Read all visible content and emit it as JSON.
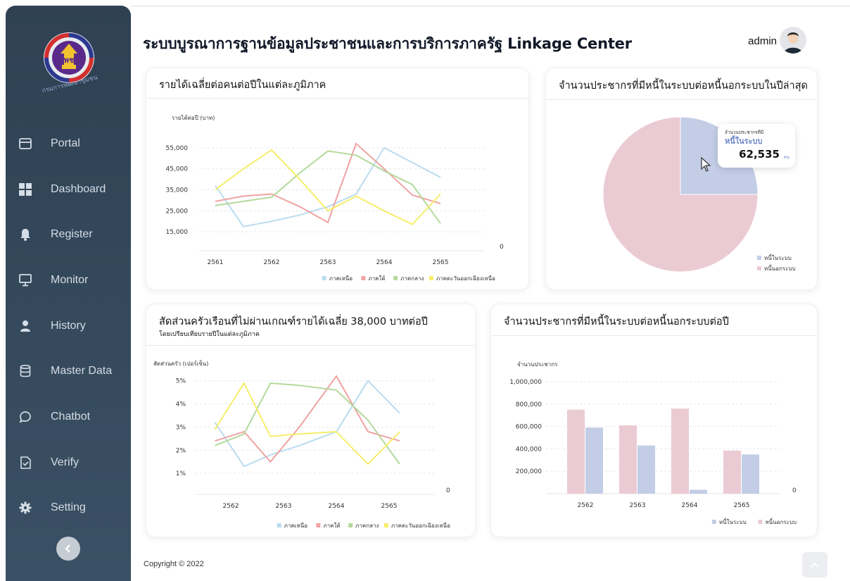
{
  "header": {
    "title": "ระบบบูรณาการฐานข้อมูลประชาชนและการบริการภาครัฐ  Linkage Center",
    "user": "admin"
  },
  "logo_text": "กรมการพัฒนาชุมชน",
  "sidebar": {
    "items": [
      {
        "label": "Portal",
        "icon": "portal-icon"
      },
      {
        "label": "Dashboard",
        "icon": "dashboard-icon"
      },
      {
        "label": "Register",
        "icon": "bell-icon"
      },
      {
        "label": "Monitor",
        "icon": "monitor-icon"
      },
      {
        "label": "History",
        "icon": "user-icon"
      },
      {
        "label": "Master Data",
        "icon": "database-icon"
      },
      {
        "label": "Chatbot",
        "icon": "chat-icon"
      },
      {
        "label": "Verify",
        "icon": "verify-icon"
      },
      {
        "label": "Setting",
        "icon": "gear-icon"
      }
    ]
  },
  "colors": {
    "north": "#b9dcef",
    "south": "#f0a3a3",
    "central": "#b5d99c",
    "northeast": "#f6ee6a",
    "in_system": "#c3cde6",
    "out_system": "#ebcbd3"
  },
  "chart_data": [
    {
      "type": "line",
      "title": "รายได้เฉลี่ยต่อคนต่อปีในแต่ละภูมิภาค",
      "ylabel": "รายได้ต่อปี (บาท)",
      "y_ticks": [
        "55,000",
        "45,000",
        "35,000",
        "25,000",
        "15,000"
      ],
      "y_tick_values": [
        55000,
        45000,
        35000,
        25000,
        15000
      ],
      "zero_label": "0",
      "categories": [
        "2561",
        "2562",
        "2563",
        "2564",
        "2565"
      ],
      "ylim": [
        5000,
        60000
      ],
      "legend_position": "bottom-right",
      "grid": true,
      "series": [
        {
          "name": "ภาคเหนือ",
          "color": "#b9dcef",
          "x": [
            1,
            1.5,
            2,
            2.5,
            3,
            3.5,
            4,
            4.5,
            5
          ],
          "values": [
            37000,
            17500,
            20000,
            23000,
            27000,
            33000,
            55000,
            48000,
            41000
          ]
        },
        {
          "name": "ภาคใต้",
          "color": "#f0a3a3",
          "x": [
            1,
            1.5,
            2,
            2.5,
            3,
            3.5,
            4,
            4.5,
            5
          ],
          "values": [
            29500,
            32000,
            33000,
            27000,
            19500,
            57000,
            45000,
            32500,
            28500
          ]
        },
        {
          "name": "ภาคกลาง",
          "color": "#b5d99c",
          "x": [
            1,
            1.5,
            2,
            2.5,
            3,
            3.5,
            4,
            4.5,
            5
          ],
          "values": [
            27500,
            29500,
            31500,
            43000,
            53500,
            51500,
            44000,
            37500,
            19000
          ]
        },
        {
          "name": "ภาคตะวันออกเฉียงเหนือ",
          "color": "#f6ee6a",
          "x": [
            1,
            1.5,
            2,
            2.5,
            3,
            3.5,
            4,
            4.5,
            5
          ],
          "values": [
            35000,
            45000,
            54000,
            40000,
            25000,
            32000,
            25000,
            18500,
            33000
          ]
        }
      ]
    },
    {
      "type": "pie",
      "title": "จำนวนประชากรที่มีหนี้ในระบบต่อหนี้นอกระบบในปีล่าสุด",
      "series": [
        {
          "name": "หนี้ในระบบ",
          "color": "#c3cde6",
          "value": 25
        },
        {
          "name": "หนี้นอกระบบ",
          "color": "#ebcbd3",
          "value": 75
        }
      ],
      "legend_position": "bottom-right",
      "tooltip": {
        "caption": "จำนวนประชากรที่มี",
        "series": "หนี้ในระบบ",
        "value": "62,535",
        "unit": "คน"
      }
    },
    {
      "type": "line",
      "title": "สัดส่วนครัวเรือนที่ไม่ผ่านเกณฑ์รายได้เฉลี่ย 38,000 บาทต่อปี",
      "subtitle": "โดยเปรียบเทียบรายปีในแต่ละภูมิภาค",
      "ylabel": "สัดส่วนครัว (เปอร์เซ็น)",
      "y_ticks": [
        "5%",
        "4%",
        "3%",
        "2%",
        "1%"
      ],
      "y_tick_values": [
        5,
        4,
        3,
        2,
        1
      ],
      "zero_label": "0",
      "categories": [
        "2562",
        "2563",
        "2564",
        "2565"
      ],
      "ylim": [
        0,
        5.6
      ],
      "legend_position": "bottom-right",
      "grid": true,
      "series": [
        {
          "name": "ภาคเหนือ",
          "color": "#b9dcef",
          "x": [
            0.7,
            1.25,
            1.75,
            2.3,
            3.0,
            3.6,
            4.2
          ],
          "values": [
            3.2,
            1.3,
            1.8,
            2.2,
            2.8,
            5.0,
            3.6
          ]
        },
        {
          "name": "ภาคใต้",
          "color": "#f0a3a3",
          "x": [
            0.7,
            1.25,
            1.75,
            2.3,
            3.0,
            3.6,
            4.2
          ],
          "values": [
            2.4,
            2.8,
            1.5,
            3.0,
            5.2,
            2.8,
            2.4
          ]
        },
        {
          "name": "ภาคกลาง",
          "color": "#b5d99c",
          "x": [
            0.7,
            1.25,
            1.75,
            2.3,
            3.0,
            3.6,
            4.2
          ],
          "values": [
            2.2,
            2.7,
            4.9,
            4.8,
            4.6,
            3.3,
            1.4
          ]
        },
        {
          "name": "ภาคตะวันออกเฉียงเหนือ",
          "color": "#f6ee6a",
          "x": [
            0.7,
            1.25,
            1.75,
            2.3,
            3.0,
            3.6,
            4.2
          ],
          "values": [
            2.9,
            4.9,
            2.6,
            2.7,
            2.8,
            1.4,
            2.8
          ]
        }
      ]
    },
    {
      "type": "bar",
      "title": "จำนวนประชากรที่มีหนี้ในระบบต่อหนี้นอกระบบต่อปี",
      "ylabel": "จำนวนประชากร",
      "y_ticks": [
        "1,000,000",
        "800,000",
        "600,000",
        "400,000",
        "200,000"
      ],
      "y_tick_values": [
        1000000,
        800000,
        600000,
        400000,
        200000
      ],
      "zero_label": "0",
      "categories": [
        "2562",
        "2563",
        "2564",
        "2565"
      ],
      "ylim": [
        0,
        1000000
      ],
      "legend_position": "bottom-right",
      "grid": true,
      "series": [
        {
          "name": "หนี้ในระบบ",
          "color": "#c3cde6",
          "values": [
            590000,
            430000,
            35000,
            350000
          ]
        },
        {
          "name": "หนี้นอกระบบ",
          "color": "#ebcbd3",
          "values": [
            750000,
            610000,
            760000,
            385000
          ]
        }
      ]
    }
  ],
  "footer": {
    "copyright": "Copyright © 2022"
  }
}
